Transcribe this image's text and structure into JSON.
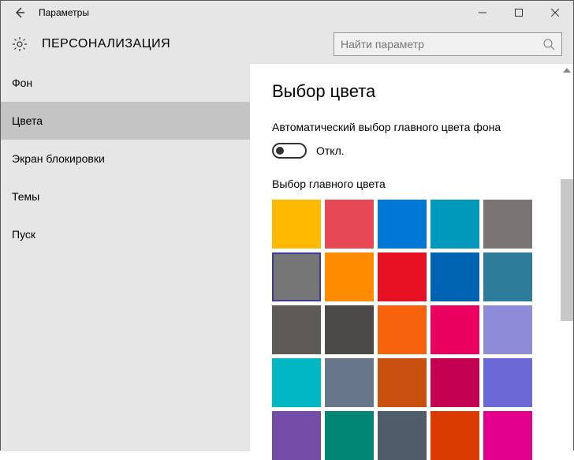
{
  "titlebar": {
    "title": "Параметры"
  },
  "header": {
    "title": "ПЕРСОНАЛИЗАЦИЯ",
    "search_placeholder": "Найти параметр"
  },
  "sidebar": {
    "items": [
      {
        "label": "Фон"
      },
      {
        "label": "Цвета"
      },
      {
        "label": "Экран блокировки"
      },
      {
        "label": "Темы"
      },
      {
        "label": "Пуск"
      }
    ],
    "selected_index": 1
  },
  "main": {
    "title": "Выбор цвета",
    "auto_color_label": "Автоматический выбор главного цвета фона",
    "toggle_state_label": "Откл.",
    "toggle_on": false,
    "grid_label": "Выбор главного цвета",
    "colors": [
      "#FFB900",
      "#E74856",
      "#0078D7",
      "#0099BC",
      "#7A7574",
      "#767676",
      "#FF8C00",
      "#E81123",
      "#0063B1",
      "#2D7D9A",
      "#5D5A58",
      "#4C4A48",
      "#F7630C",
      "#EA005E",
      "#8E8CD8",
      "#00B7C3",
      "#68768A",
      "#CA5010",
      "#C30052",
      "#6B69D6",
      "#744DA9",
      "#018574",
      "#515C6B",
      "#DA3B01",
      "#E3008C"
    ],
    "selected_color_index": 5
  }
}
